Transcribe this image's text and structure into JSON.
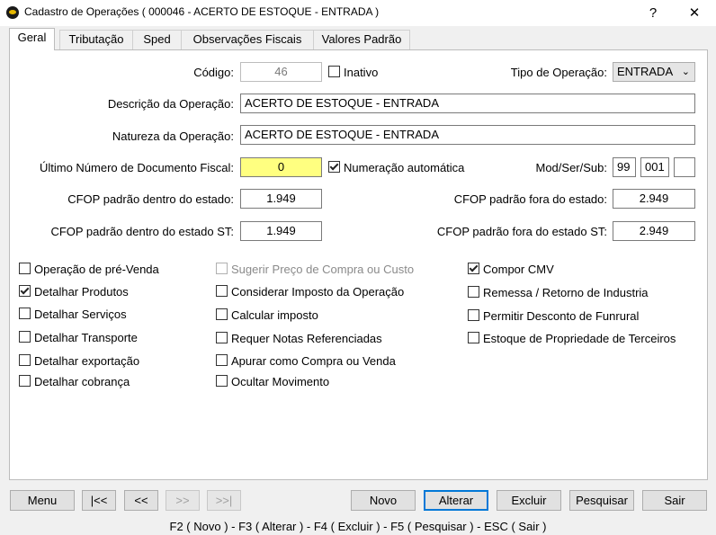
{
  "window": {
    "title": "Cadastro de Operações ( 000046 - ACERTO DE ESTOQUE - ENTRADA )",
    "help_glyph": "?",
    "close_glyph": "✕"
  },
  "tabs": [
    {
      "label": "Geral"
    },
    {
      "label": "Tributação"
    },
    {
      "label": "Sped"
    },
    {
      "label": "Observações Fiscais"
    },
    {
      "label": "Valores Padrão"
    }
  ],
  "form": {
    "codigo_label": "Código:",
    "codigo_value": "46",
    "inativo_label": "Inativo",
    "tipo_label": "Tipo de Operação:",
    "tipo_value": "ENTRADA",
    "descricao_label": "Descrição da Operação:",
    "descricao_value": "ACERTO DE ESTOQUE - ENTRADA",
    "natureza_label": "Natureza da Operação:",
    "natureza_value": "ACERTO DE ESTOQUE - ENTRADA",
    "ultimo_label": "Último Número de Documento Fiscal:",
    "ultimo_value": "0",
    "numeracao_label": "Numeração automática",
    "modsersub_label": "Mod/Ser/Sub:",
    "mod_value": "99",
    "ser_value": "001",
    "sub_value": "",
    "cfop_dentro_label": "CFOP padrão dentro do estado:",
    "cfop_dentro_value": "1.949",
    "cfop_fora_label": "CFOP padrão fora do estado:",
    "cfop_fora_value": "2.949",
    "cfop_dentro_st_label": "CFOP padrão dentro do estado ST:",
    "cfop_dentro_st_value": "1.949",
    "cfop_fora_st_label": "CFOP padrão fora do estado ST:",
    "cfop_fora_st_value": "2.949"
  },
  "checkboxes": {
    "col1": [
      {
        "label": "Operação de pré-Venda"
      },
      {
        "label": "Detalhar Produtos"
      },
      {
        "label": "Detalhar Serviços"
      },
      {
        "label": "Detalhar Transporte"
      },
      {
        "label": "Detalhar exportação"
      },
      {
        "label": "Detalhar cobrança"
      }
    ],
    "col2": [
      {
        "label": "Sugerir Preço de Compra ou Custo"
      },
      {
        "label": "Considerar Imposto da Operação"
      },
      {
        "label": "Calcular imposto"
      },
      {
        "label": "Requer Notas Referenciadas"
      },
      {
        "label": "Apurar como Compra ou Venda"
      },
      {
        "label": "Ocultar Movimento"
      }
    ],
    "col3": [
      {
        "label": "Compor CMV"
      },
      {
        "label": "Remessa / Retorno de Industria"
      },
      {
        "label": "Permitir Desconto de Funrural"
      },
      {
        "label": "Estoque de Propriedade de Terceiros"
      }
    ]
  },
  "buttons": {
    "menu": "Menu",
    "first": "|<<",
    "prev": "<<",
    "next": ">>",
    "last": ">>|",
    "novo": "Novo",
    "alterar": "Alterar",
    "excluir": "Excluir",
    "pesquisar": "Pesquisar",
    "sair": "Sair"
  },
  "statusbar": {
    "text": "F2 ( Novo )  -  F3 ( Alterar )  -  F4 ( Excluir )  -  F5 ( Pesquisar )  -  ESC ( Sair )"
  }
}
